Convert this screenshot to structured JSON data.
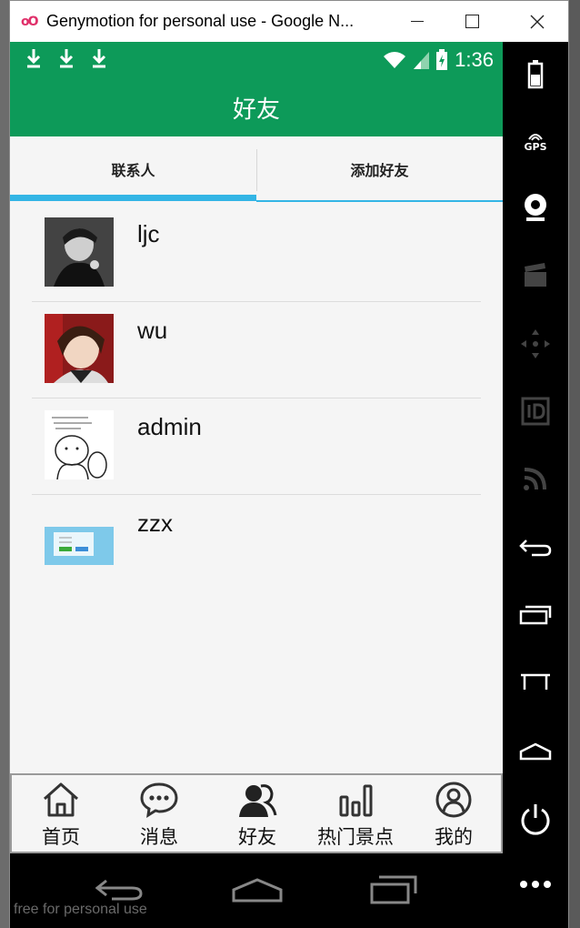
{
  "window": {
    "title": "Genymotion for personal use - Google N..."
  },
  "statusbar": {
    "time": "1:36"
  },
  "appbar": {
    "title": "好友"
  },
  "tabs": [
    {
      "label": "联系人",
      "active": true
    },
    {
      "label": "添加好友",
      "active": false
    }
  ],
  "contacts": [
    {
      "name": "ljc"
    },
    {
      "name": "wu"
    },
    {
      "name": "admin"
    },
    {
      "name": "zzx"
    }
  ],
  "bottom_nav": [
    {
      "label": "首页",
      "icon": "home-icon"
    },
    {
      "label": "消息",
      "icon": "chat-bubble-icon"
    },
    {
      "label": "好友",
      "icon": "friends-icon",
      "active": true
    },
    {
      "label": "热门景点",
      "icon": "bar-chart-icon"
    },
    {
      "label": "我的",
      "icon": "user-circle-icon"
    }
  ],
  "toolbar": {
    "gps_label": "GPS"
  },
  "watermark": "free for personal use",
  "colors": {
    "primary": "#0d9a59",
    "tab_indicator": "#33b5e5"
  }
}
